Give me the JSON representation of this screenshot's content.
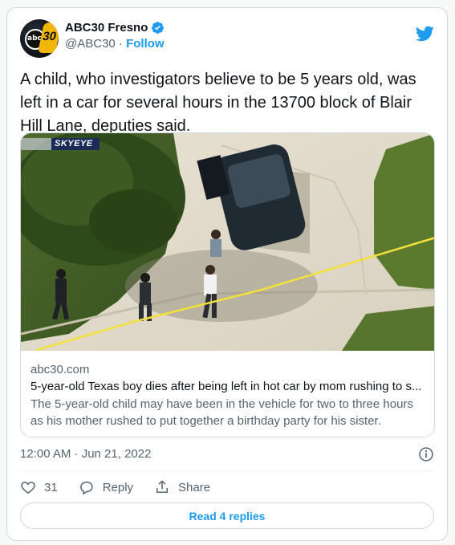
{
  "author": {
    "display_name": "ABC30 Fresno",
    "handle": "@ABC30",
    "separator": " · ",
    "follow_label": "Follow",
    "avatar_text": "abc",
    "avatar_number": "30"
  },
  "tweet": {
    "text": "A child, who investigators believe to be 5 years old, was left in a car for several hours in the 13700 block of Blair Hill Lane, deputies said."
  },
  "media": {
    "watermark": "SKYEYE",
    "domain": "abc30.com",
    "title": "5-year-old Texas boy dies after being left in hot car by mom rushing to s...",
    "description": "The 5-year-old child may have been in the vehicle for two to three hours as his mother rushed to put together a birthday party for his sister."
  },
  "meta": {
    "timestamp": "12:00 AM · Jun 21, 2022"
  },
  "actions": {
    "like_count": "31",
    "reply_label": "Reply",
    "share_label": "Share"
  },
  "footer": {
    "read_replies_label": "Read 4 replies"
  },
  "colors": {
    "accent": "#1d9bf0",
    "text_primary": "#0f1419",
    "text_secondary": "#536471",
    "border": "#cfd9de",
    "tape_yellow": "#f3e03b"
  },
  "icons": [
    "verified-badge-icon",
    "twitter-bird-icon",
    "info-icon",
    "heart-icon",
    "reply-bubble-icon",
    "share-icon"
  ]
}
